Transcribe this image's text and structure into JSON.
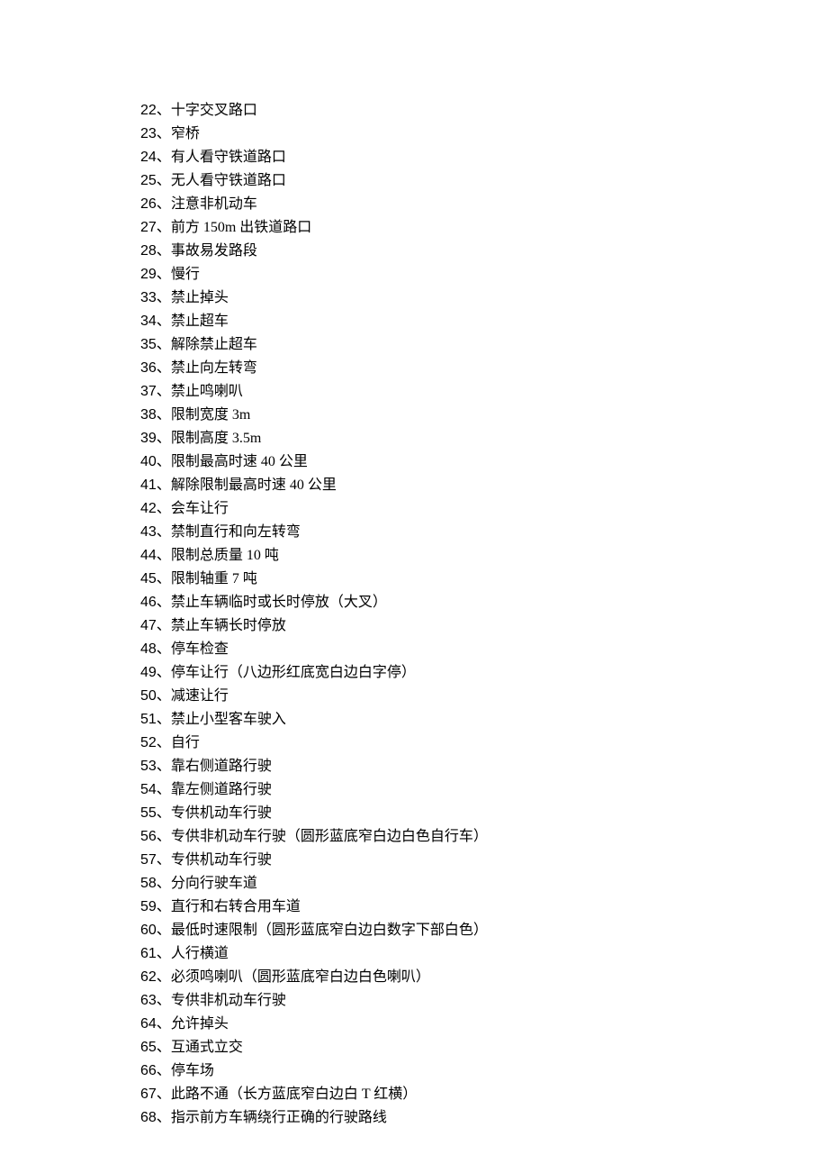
{
  "items": [
    {
      "number": "22",
      "separator": "、",
      "text": "十字交叉路口"
    },
    {
      "number": "23",
      "separator": "、",
      "text": "窄桥"
    },
    {
      "number": "24",
      "separator": "、",
      "text": "有人看守铁道路口"
    },
    {
      "number": "25",
      "separator": "、",
      "text": "无人看守铁道路口"
    },
    {
      "number": "26",
      "separator": "、",
      "text": "注意非机动车"
    },
    {
      "number": "27",
      "separator": "、",
      "text": "前方 150m 出铁道路口"
    },
    {
      "number": "28",
      "separator": "、",
      "text": "事故易发路段"
    },
    {
      "number": "29",
      "separator": "、",
      "text": "慢行"
    },
    {
      "number": "33",
      "separator": "、",
      "text": "禁止掉头"
    },
    {
      "number": "34",
      "separator": "、",
      "text": "禁止超车"
    },
    {
      "number": "35",
      "separator": "、",
      "text": "解除禁止超车"
    },
    {
      "number": "36",
      "separator": "、",
      "text": "禁止向左转弯"
    },
    {
      "number": "37",
      "separator": "、",
      "text": "禁止鸣喇叭"
    },
    {
      "number": "38",
      "separator": "、",
      "text": "限制宽度 3m"
    },
    {
      "number": "39",
      "separator": "、",
      "text": "限制高度 3.5m"
    },
    {
      "number": "40",
      "separator": "、",
      "text": "限制最高时速 40 公里"
    },
    {
      "number": "41",
      "separator": "、",
      "text": "解除限制最高时速 40 公里"
    },
    {
      "number": "42",
      "separator": "、",
      "text": "会车让行"
    },
    {
      "number": "43",
      "separator": "、",
      "text": "禁制直行和向左转弯"
    },
    {
      "number": "44",
      "separator": "、",
      "text": "限制总质量 10 吨"
    },
    {
      "number": "45",
      "separator": "、",
      "text": "限制轴重 7 吨"
    },
    {
      "number": "46",
      "separator": "、",
      "text": "禁止车辆临时或长时停放（大叉）"
    },
    {
      "number": "47",
      "separator": "、",
      "text": "禁止车辆长时停放"
    },
    {
      "number": "48",
      "separator": "、",
      "text": "停车检查"
    },
    {
      "number": "49",
      "separator": "、",
      "text": "停车让行（八边形红底宽白边白字停）"
    },
    {
      "number": "50",
      "separator": "、",
      "text": "减速让行"
    },
    {
      "number": "51",
      "separator": "、",
      "text": "禁止小型客车驶入"
    },
    {
      "number": "52",
      "separator": "、",
      "text": "自行"
    },
    {
      "number": "53",
      "separator": "、",
      "text": "靠右侧道路行驶"
    },
    {
      "number": "54",
      "separator": "、",
      "text": "靠左侧道路行驶"
    },
    {
      "number": "55",
      "separator": "、",
      "text": "专供机动车行驶"
    },
    {
      "number": "56",
      "separator": "、",
      "text": "专供非机动车行驶（圆形蓝底窄白边白色自行车）"
    },
    {
      "number": "57",
      "separator": "、",
      "text": "专供机动车行驶"
    },
    {
      "number": "58",
      "separator": "、",
      "text": "分向行驶车道"
    },
    {
      "number": "59",
      "separator": "、",
      "text": "直行和右转合用车道"
    },
    {
      "number": "60",
      "separator": "、",
      "text": "最低时速限制（圆形蓝底窄白边白数字下部白色）"
    },
    {
      "number": "61",
      "separator": "、",
      "text": "人行横道"
    },
    {
      "number": "62",
      "separator": "、",
      "text": "必须鸣喇叭（圆形蓝底窄白边白色喇叭）"
    },
    {
      "number": "63",
      "separator": "、",
      "text": "专供非机动车行驶"
    },
    {
      "number": "64",
      "separator": "、",
      "text": "允许掉头"
    },
    {
      "number": "65",
      "separator": "、",
      "text": "互通式立交"
    },
    {
      "number": "66",
      "separator": "、",
      "text": "停车场"
    },
    {
      "number": "67",
      "separator": "、",
      "text": "此路不通（长方蓝底窄白边白 T 红横）"
    },
    {
      "number": "68",
      "separator": "、",
      "text": "指示前方车辆绕行正确的行驶路线"
    }
  ]
}
